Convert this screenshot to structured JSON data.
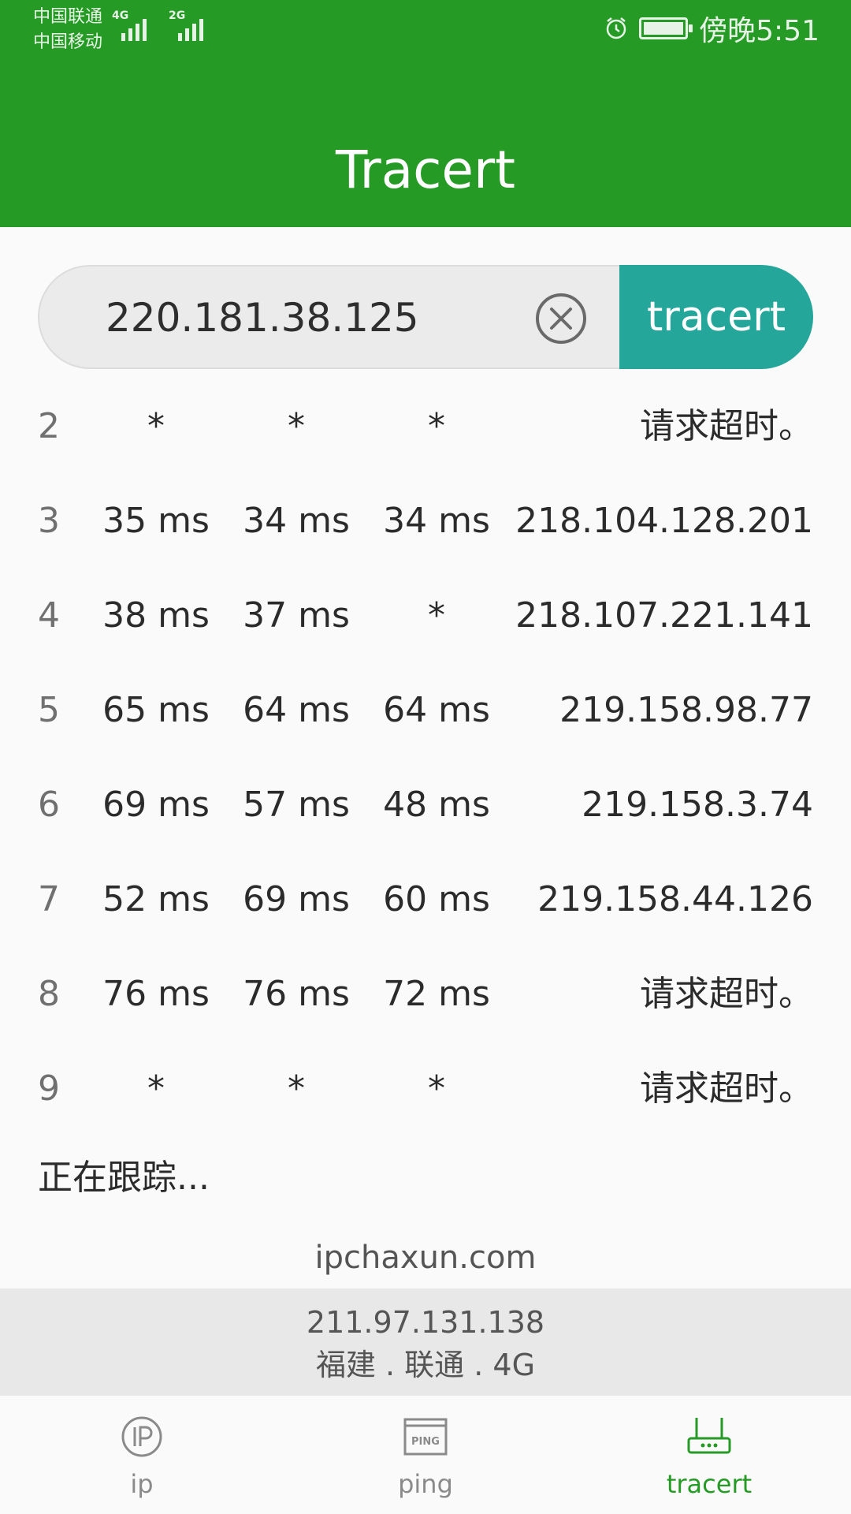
{
  "status_bar": {
    "carrier1": "中国联通",
    "carrier2": "中国移动",
    "network1": "4G",
    "network2": "2G",
    "time": "傍晚5:51",
    "icons": [
      "signal-icon",
      "alarm-icon",
      "battery-icon"
    ]
  },
  "header": {
    "title": "Tracert"
  },
  "search": {
    "value": "220.181.38.125",
    "button_label": "tracert"
  },
  "results": [
    {
      "hop": "2",
      "t1": "*",
      "t2": "*",
      "t3": "*",
      "address": "请求超时。"
    },
    {
      "hop": "3",
      "t1": "35 ms",
      "t2": "34 ms",
      "t3": "34 ms",
      "address": "218.104.128.201"
    },
    {
      "hop": "4",
      "t1": "38 ms",
      "t2": "37 ms",
      "t3": "*",
      "address": "218.107.221.141"
    },
    {
      "hop": "5",
      "t1": "65 ms",
      "t2": "64 ms",
      "t3": "64 ms",
      "address": "219.158.98.77"
    },
    {
      "hop": "6",
      "t1": "69 ms",
      "t2": "57 ms",
      "t3": "48 ms",
      "address": "219.158.3.74"
    },
    {
      "hop": "7",
      "t1": "52 ms",
      "t2": "69 ms",
      "t3": "60 ms",
      "address": "219.158.44.126"
    },
    {
      "hop": "8",
      "t1": "76 ms",
      "t2": "76 ms",
      "t3": "72 ms",
      "address": "请求超时。"
    },
    {
      "hop": "9",
      "t1": "*",
      "t2": "*",
      "t3": "*",
      "address": "请求超时。"
    }
  ],
  "status_text": "正在跟踪...",
  "footer": {
    "site": "ipchaxun.com",
    "ip": "211.97.131.138",
    "location": "福建 . 联通 . 4G"
  },
  "nav": {
    "items": [
      {
        "label": "ip",
        "icon": "ip-icon"
      },
      {
        "label": "ping",
        "icon": "ping-icon"
      },
      {
        "label": "tracert",
        "icon": "router-icon",
        "active": true
      }
    ]
  },
  "colors": {
    "header": "#259a25",
    "button": "#25a69a",
    "active_nav": "#259a25"
  }
}
